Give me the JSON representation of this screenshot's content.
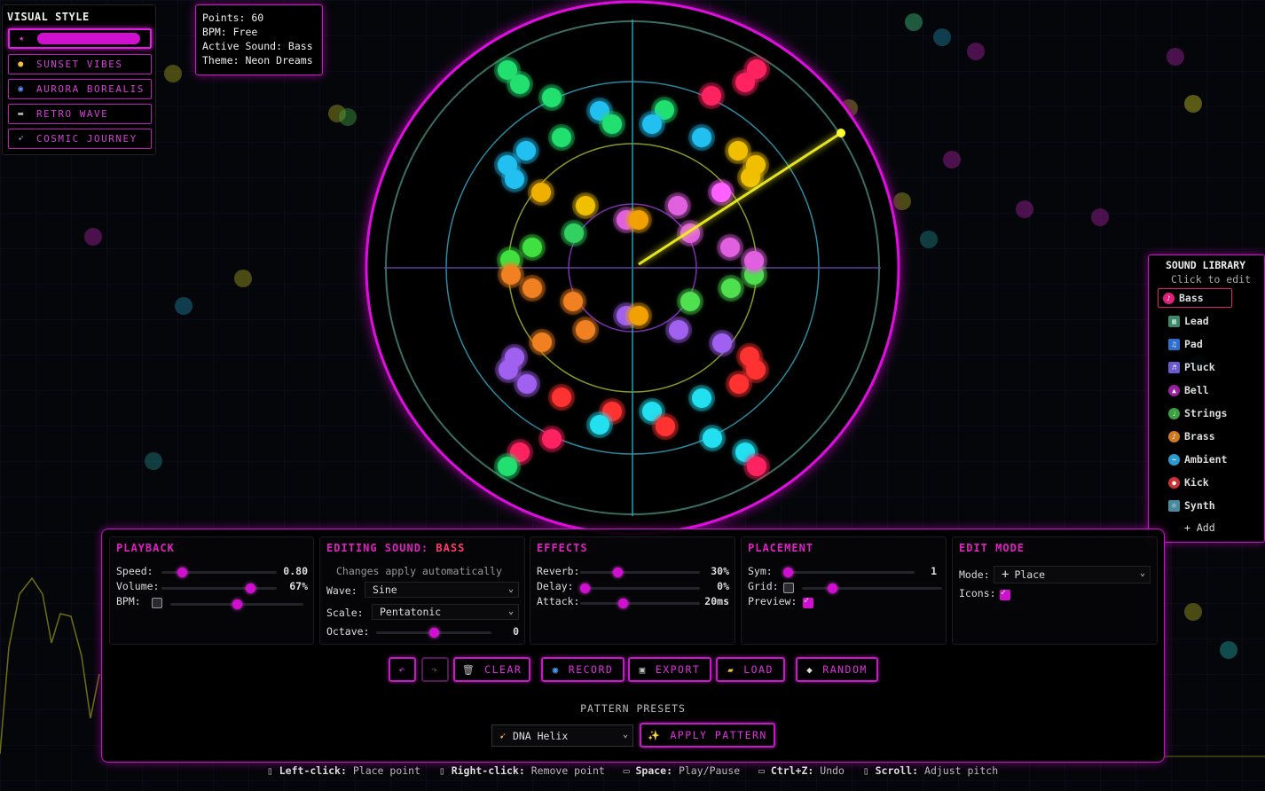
{
  "visual_style": {
    "title": "VISUAL STYLE",
    "options": [
      {
        "label": "",
        "icon": "star-icon",
        "active": true
      },
      {
        "label": "SUNSET VIBES",
        "icon": "person-icon",
        "active": false
      },
      {
        "label": "AURORA BOREALIS",
        "icon": "galaxy-icon",
        "active": false
      },
      {
        "label": "RETRO WAVE",
        "icon": "gamepad-icon",
        "active": false
      },
      {
        "label": "COSMIC JOURNEY",
        "icon": "comet-icon",
        "active": false
      }
    ]
  },
  "info": {
    "points": "Points: 60",
    "bpm": "BPM: Free",
    "active_sound": "Active Sound: Bass",
    "theme": "Theme: Neon Dreams"
  },
  "sound_library": {
    "title": "SOUND LIBRARY",
    "subtitle": "Click to edit",
    "sounds": [
      {
        "label": "Bass",
        "icon": "bass-icon",
        "color": "#e0207a",
        "active": true
      },
      {
        "label": "Lead",
        "icon": "piano-icon",
        "color": "#3a8a6a",
        "active": false
      },
      {
        "label": "Pad",
        "icon": "note-icon",
        "color": "#2d6fd0",
        "active": false
      },
      {
        "label": "Pluck",
        "icon": "pluck-icon",
        "color": "#6a5ad0",
        "active": false
      },
      {
        "label": "Bell",
        "icon": "bell-icon",
        "color": "#d9a000",
        "active": false
      },
      {
        "label": "Strings",
        "icon": "violin-icon",
        "color": "#3aa040",
        "active": false
      },
      {
        "label": "Brass",
        "icon": "trumpet-icon",
        "color": "#d07a20",
        "active": false
      },
      {
        "label": "Ambient",
        "icon": "wave-icon",
        "color": "#2a9ad0",
        "active": false
      },
      {
        "label": "Kick",
        "icon": "drum-icon",
        "color": "#d03030",
        "active": false
      },
      {
        "label": "Synth",
        "icon": "dice-icon",
        "color": "#4a8aa0",
        "active": false
      }
    ],
    "add_label": "+ Add"
  },
  "playback": {
    "title": "PLAYBACK",
    "speed_label": "Speed:",
    "speed_value": "0.80",
    "speed_level": 0.15,
    "volume_label": "Volume:",
    "volume_value": "67%",
    "volume_level": 0.8,
    "bpm_label": "BPM:",
    "bpm_enabled": false,
    "bpm_level": 0.5
  },
  "editing": {
    "title_prefix": "EDITING SOUND:",
    "title_sound": "BASS",
    "note": "Changes apply automatically",
    "wave_label": "Wave:",
    "wave_value": "Sine",
    "scale_label": "Scale:",
    "scale_value": "Pentatonic",
    "octave_label": "Octave:",
    "octave_value": "0",
    "octave_level": 0.5
  },
  "effects": {
    "title": "EFFECTS",
    "reverb_label": "Reverb:",
    "reverb_value": "30%",
    "reverb_level": 0.3,
    "delay_label": "Delay:",
    "delay_value": "0%",
    "delay_level": 0.0,
    "attack_label": "Attack:",
    "attack_value": "20ms",
    "attack_level": 0.35
  },
  "placement": {
    "title": "PLACEMENT",
    "sym_label": "Sym:",
    "sym_value": "1",
    "sym_level": 0.0,
    "grid_label": "Grid:",
    "grid_enabled": false,
    "grid_level": 0.2,
    "preview_label": "Preview:",
    "preview_enabled": true
  },
  "edit_mode": {
    "title": "EDIT MODE",
    "mode_label": "Mode:",
    "mode_value": "Place",
    "icons_label": "Icons:",
    "icons_enabled": true
  },
  "actions": {
    "undo": "↶",
    "redo": "↷",
    "clear": "CLEAR",
    "record": "RECORD",
    "export": "EXPORT",
    "load": "LOAD",
    "random": "RANDOM"
  },
  "presets": {
    "title": "PATTERN PRESETS",
    "selected": "DNA Helix",
    "apply_label": "APPLY PATTERN"
  },
  "hints": [
    {
      "key": "Left-click:",
      "desc": "Place point"
    },
    {
      "key": "Right-click:",
      "desc": "Remove point"
    },
    {
      "key": "Space:",
      "desc": "Play/Pause"
    },
    {
      "key": "Ctrl+Z:",
      "desc": "Undo"
    },
    {
      "key": "Scroll:",
      "desc": "Adjust pitch"
    }
  ],
  "colors": {
    "accent": "#d010d0",
    "ring_inner": "#c0c020",
    "ring_mid": "#20b0c0"
  }
}
